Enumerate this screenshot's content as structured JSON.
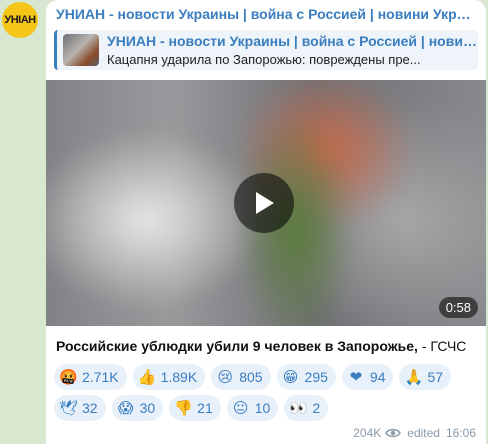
{
  "channel": {
    "avatar_text": "УНIAН",
    "title": "УНИАН - новости Украины | война с Россией | новини Украї..."
  },
  "reply": {
    "title": "УНИАН - новости Украины | война с Россией | новин...",
    "text": "Кацапня ударила по Запорожью: повреждены пре..."
  },
  "video": {
    "duration": "0:58",
    "play_icon": "play-icon"
  },
  "caption": {
    "bold": "Российские ублюдки убили 9 человек в Запорожье,",
    "rest": " - ГСЧС"
  },
  "reactions": [
    {
      "emoji": "🤬",
      "count": "2.71K"
    },
    {
      "emoji": "👍",
      "count": "1.89K"
    },
    {
      "emoji": "😢",
      "count": "805"
    },
    {
      "emoji": "😁",
      "count": "295"
    },
    {
      "emoji": "❤",
      "count": "94"
    },
    {
      "emoji": "🙏",
      "count": "57"
    },
    {
      "emoji": "🕊",
      "count": "32"
    },
    {
      "emoji": "😱",
      "count": "30"
    },
    {
      "emoji": "👎",
      "count": "21"
    },
    {
      "emoji": "😐",
      "count": "10"
    },
    {
      "emoji": "👀",
      "count": "2"
    }
  ],
  "meta": {
    "views": "204K",
    "edited": "edited",
    "time": "16:06"
  },
  "colors": {
    "accent": "#3a7ebf",
    "background": "#d9e6d0",
    "avatar": "#f5c518"
  }
}
